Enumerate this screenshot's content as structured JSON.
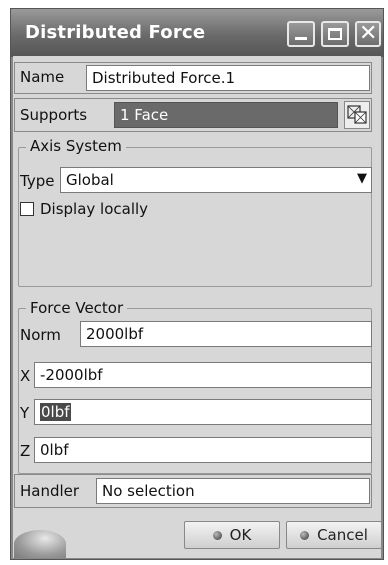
{
  "window": {
    "title": "Distributed Force"
  },
  "name": {
    "label": "Name",
    "value": "Distributed Force.1"
  },
  "supports": {
    "label": "Supports",
    "value": "1 Face"
  },
  "axis_system": {
    "legend": "Axis System",
    "type_label": "Type",
    "type_value": "Global",
    "display_locally": "Display locally"
  },
  "force_vector": {
    "legend": "Force Vector",
    "norm_label": "Norm",
    "norm_value": "2000lbf",
    "x_label": "X",
    "x_value": "-2000lbf",
    "y_label": "Y",
    "y_value": "0lbf",
    "z_label": "Z",
    "z_value": "0lbf"
  },
  "handler": {
    "label": "Handler",
    "value": "No selection"
  },
  "buttons": {
    "ok": "OK",
    "cancel": "Cancel"
  }
}
